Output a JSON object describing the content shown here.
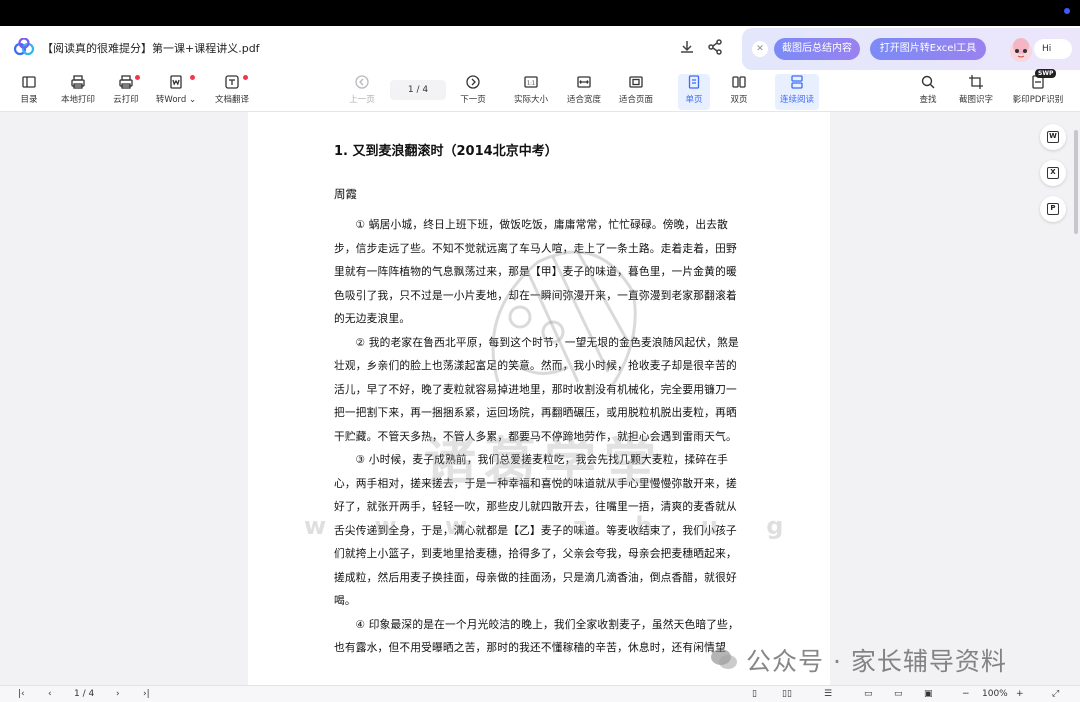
{
  "window": {
    "title": "【阅读真的很难提分】第一课+课程讲义.pdf"
  },
  "promo": {
    "btn1": "截图后总结内容",
    "btn2": "打开图片转Excel工具",
    "hi": "Hi"
  },
  "toolbar": {
    "contents": "目录",
    "local_print": "本地打印",
    "cloud_print": "云打印",
    "to_word": "转Word",
    "translate": "文档翻译",
    "prev_page": "上一页",
    "page_indicator": "1 / 4",
    "next_page": "下一页",
    "actual_size": "实际大小",
    "fit_width": "适合宽度",
    "fit_page": "适合页面",
    "single_page": "单页",
    "double_page": "双页",
    "continuous": "连续阅读",
    "search": "查找",
    "ocr": "截图识字",
    "pdf_ocr": "影印PDF识别",
    "badge": "SWP"
  },
  "document": {
    "heading": "1. 又到麦浪翻滚时（2014北京中考）",
    "author": "周霞",
    "paragraphs": [
      "① 蜗居小城，终日上班下班，做饭吃饭，庸庸常常，忙忙碌碌。傍晚，出去散步，信步走远了些。不知不觉就远离了车马人喧，走上了一条土路。走着走着，田野里就有一阵阵植物的气息飘荡过来，那是【甲】麦子的味道，暮色里，一片金黄的暖色吸引了我，只不过是一小片麦地，却在一瞬间弥漫开来，一直弥漫到老家那翻滚着的无边麦浪里。",
      "② 我的老家在鲁西北平原，每到这个时节，一望无垠的金色麦浪随风起伏，煞是壮观，乡亲们的脸上也荡漾起富足的笑意。然而，我小时候，抢收麦子却是很辛苦的活儿，早了不好，晚了麦粒就容易掉进地里，那时收割没有机械化，完全要用镰刀一把一把割下来，再一捆捆系紧，运回场院，再翻晒碾压，或用脱粒机脱出麦粒，再晒干贮藏。不管天多热，不管人多累，都要马不停蹄地劳作，就担心会遇到雷雨天气。",
      "③ 小时候，麦子成熟前，我们总爱搓麦粒吃，我会先找几颗大麦粒，揉碎在手心，两手相对，搓来搓去，于是一种幸福和喜悦的味道就从手心里慢慢弥散开来，搓好了，就张开两手，轻轻一吹，那些皮儿就四散开去，往嘴里一捂，清爽的麦香就从舌尖传递到全身，于是，满心就都是【乙】麦子的味道。等麦收结束了，我们小孩子们就挎上小篮子，到麦地里拾麦穗，拾得多了，父亲会夸我，母亲会把麦穗晒起来，搓成粒，然后用麦子换挂面，母亲做的挂面汤，只是滴几滴香油，倒点香醋，就很好喝。",
      "④ 印象最深的是在一个月光皎洁的晚上，我们全家收割麦子，虽然天色暗了些，也有露水，但不用受曝晒之苦，那时的我还不懂稼穑的辛苦，休息时，还有闲情望"
    ]
  },
  "watermark": {
    "text": "诸葛学堂",
    "url": "w w w . z h u g e x t . c o m",
    "footer": "公众号 · 家长辅导资料"
  },
  "status": {
    "page": "1 / 4",
    "zoom": "100%"
  }
}
